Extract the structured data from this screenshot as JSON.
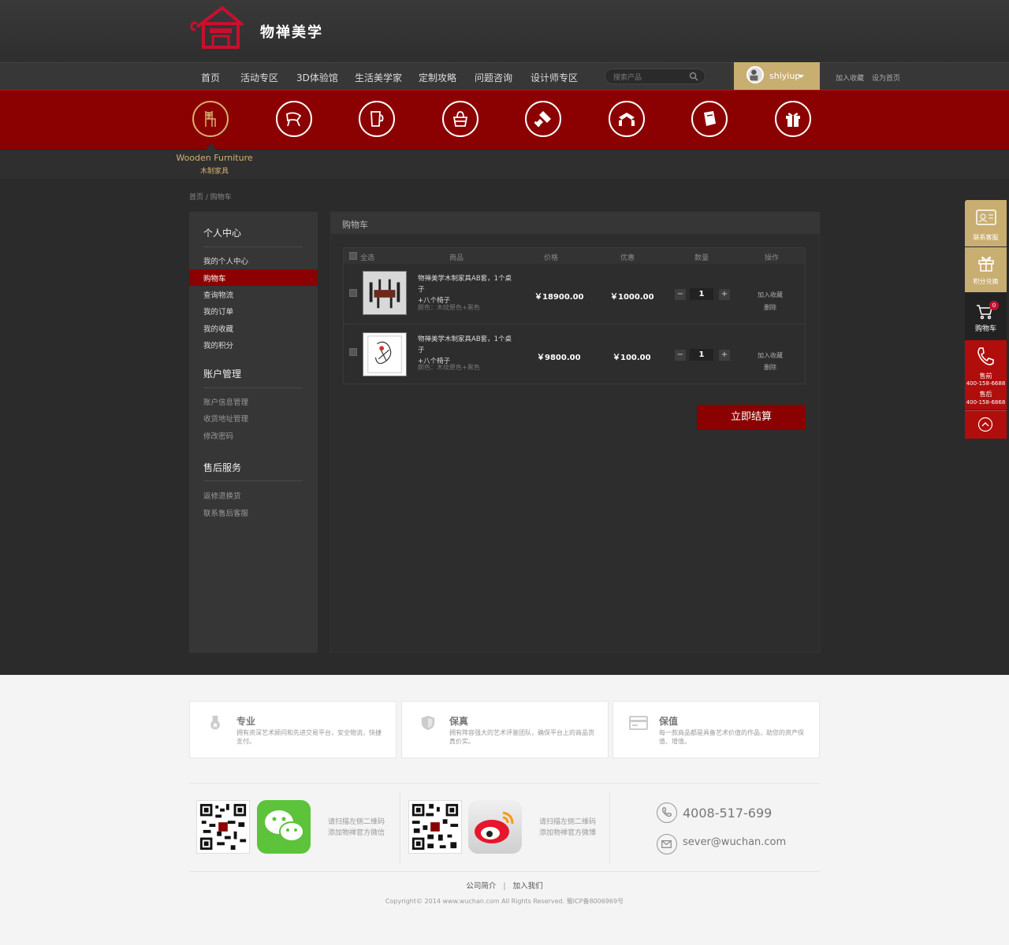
{
  "brand": {
    "name": "物禅美学"
  },
  "nav": {
    "items": [
      "首页",
      "活动专区",
      "3D体验馆",
      "生活美学家",
      "定制攻略",
      "问题咨询",
      "设计师专区"
    ],
    "search_placeholder": "搜索产品",
    "username": "shiyiup",
    "add_favorite": "加入收藏",
    "set_home": "设为首页"
  },
  "category": {
    "active_en": "Wooden Furniture",
    "active_cn": "木制家具",
    "icons": [
      "chair-icon",
      "lounge-chair-icon",
      "cup-icon",
      "bag-icon",
      "brush-icon",
      "scarf-icon",
      "notebook-icon",
      "gift-icon"
    ]
  },
  "breadcrumb": "首页 / 购物车",
  "sidebar": {
    "groups": [
      {
        "title": "个人中心",
        "items": [
          "我的个人中心",
          "购物车",
          "查询物流",
          "我的订单",
          "我的收藏",
          "我的积分"
        ],
        "active": "购物车"
      },
      {
        "title": "账户管理",
        "items": [
          "账户信息管理",
          "收货地址管理",
          "修改密码"
        ]
      },
      {
        "title": "售后服务",
        "items": [
          "返修退换货",
          "联系售后客服"
        ]
      }
    ]
  },
  "cart": {
    "title": "购物车",
    "headers": [
      "全选",
      "商品",
      "价格",
      "优惠",
      "数量",
      "操作"
    ],
    "rows": [
      {
        "name_line1": "物禅美学木制家具AB套，1个桌子",
        "name_line2": "+八个椅子",
        "attr": "颜色：木纹原色+黑色",
        "price": "￥18900.00",
        "discount": "￥1000.00",
        "qty": "1",
        "op1": "加入收藏",
        "op2": "删除"
      },
      {
        "name_line1": "物禅美学木制家具AB套，1个桌子",
        "name_line2": "+八个椅子",
        "attr": "颜色：木纹原色+黑色",
        "price": "￥9800.00",
        "discount": "￥100.00",
        "qty": "1",
        "op1": "加入收藏",
        "op2": "删除"
      }
    ],
    "qty_minus": "−",
    "qty_plus": "+",
    "checkout": "立即结算"
  },
  "float_bar": {
    "service": "联系客服",
    "points": "积分兑换",
    "cart": "购物车",
    "cart_count": "0",
    "presale_label": "售前",
    "presale_phone": "400-158-6688",
    "aftersale_label": "售后",
    "aftersale_phone": "400-158-6868"
  },
  "footer": {
    "features": [
      {
        "title": "专业",
        "desc": "拥有资深艺术顾问和先进交易平台，安全物流，快捷支付。"
      },
      {
        "title": "保真",
        "desc": "拥有阵容强大的艺术评鉴团队，确保平台上的商品货真价实。"
      },
      {
        "title": "保值",
        "desc": "每一款商品都是具备艺术价值的作品，助您的资产保值、增值。"
      }
    ],
    "wechat_line1": "请扫描左侧二维码",
    "wechat_line2": "添加物禅官方微信",
    "weibo_line1": "请扫描左侧二维码",
    "weibo_line2": "添加物禅官方微博",
    "phone": "4008-517-699",
    "email": "sever@wuchan.com",
    "link1": "公司简介",
    "link_sep": "|",
    "link2": "加入我们",
    "copyright": "Copyright© 2014 www.wuchan.com All Rights Reserved. 蜀ICP备8006969号"
  },
  "colors": {
    "brand_red": "#8b0000",
    "gold": "#c9ae72",
    "dark_bg": "#2b2b2b"
  }
}
